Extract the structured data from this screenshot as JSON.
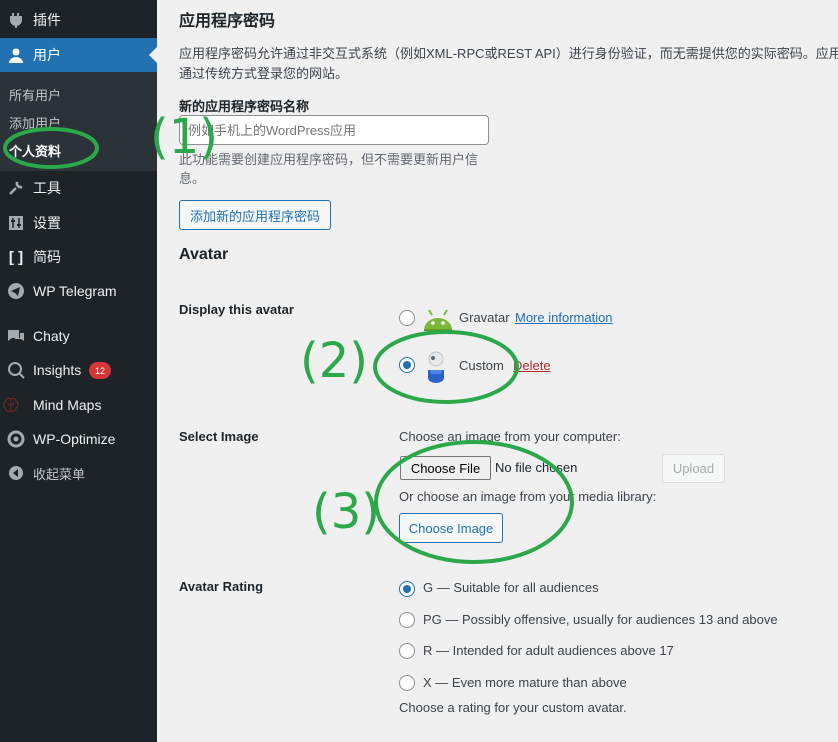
{
  "sidebar": {
    "items": [
      {
        "label": "插件",
        "icon": "plugin-icon"
      },
      {
        "label": "用户",
        "icon": "user-icon",
        "current": true
      },
      {
        "label": "工具",
        "icon": "wrench-icon"
      },
      {
        "label": "设置",
        "icon": "settings-icon"
      },
      {
        "label": "简码",
        "icon": "shortcode-icon"
      },
      {
        "label": "WP Telegram",
        "icon": "telegram-icon"
      },
      {
        "label": "Chaty",
        "icon": "chat-icon"
      },
      {
        "label": "Insights",
        "icon": "insights-icon",
        "badge": "12"
      },
      {
        "label": "Mind Maps",
        "icon": "brain-icon"
      },
      {
        "label": "WP-Optimize",
        "icon": "optimize-icon"
      },
      {
        "label": "收起菜单",
        "icon": "collapse-icon"
      }
    ],
    "submenu": [
      {
        "label": "所有用户"
      },
      {
        "label": "添加用户"
      },
      {
        "label": "个人资料",
        "current": true
      }
    ]
  },
  "app_passwords": {
    "title": "应用程序密码",
    "description_line1": "应用程序密码允许通过非交互式系统（例如XML-RPC或REST API）进行身份验证，而无需提供您的实际密码。应用程",
    "description_line2": "通过传统方式登录您的网站。",
    "new_name_label": "新的应用程序密码名称",
    "new_name_placeholder": "例如手机上的WordPress应用",
    "help_line1": "此功能需要创建应用程序密码，但不需要更新用户信",
    "help_line2": "息。",
    "add_button": "添加新的应用程序密码"
  },
  "avatar": {
    "heading": "Avatar",
    "display_label": "Display this avatar",
    "gravatar_label": "Gravatar",
    "gravatar_link": "More information",
    "custom_label": "Custom",
    "custom_delete": "Delete",
    "selected": "custom"
  },
  "select_image": {
    "label": "Select Image",
    "choose_computer": "Choose an image from your computer:",
    "file_button": "Choose File",
    "file_status": "No file chosen",
    "upload_button": "Upload",
    "choose_media": "Or choose an image from your media library:",
    "choose_image_button": "Choose Image"
  },
  "rating": {
    "label": "Avatar Rating",
    "options": [
      {
        "text": "G — Suitable for all audiences",
        "checked": true
      },
      {
        "text": "PG — Possibly offensive, usually for audiences 13 and above"
      },
      {
        "text": "R — Intended for adult audiences above 17"
      },
      {
        "text": "X — Even more mature than above"
      }
    ],
    "help": "Choose a rating for your custom avatar."
  },
  "annotations": {
    "one": "(1)",
    "two": "(2)",
    "three": "(3)",
    "color": "#2aa84a"
  },
  "colors": {
    "sidebar_bg": "#1d2327",
    "accent": "#2271b1",
    "badge": "#d63638"
  }
}
